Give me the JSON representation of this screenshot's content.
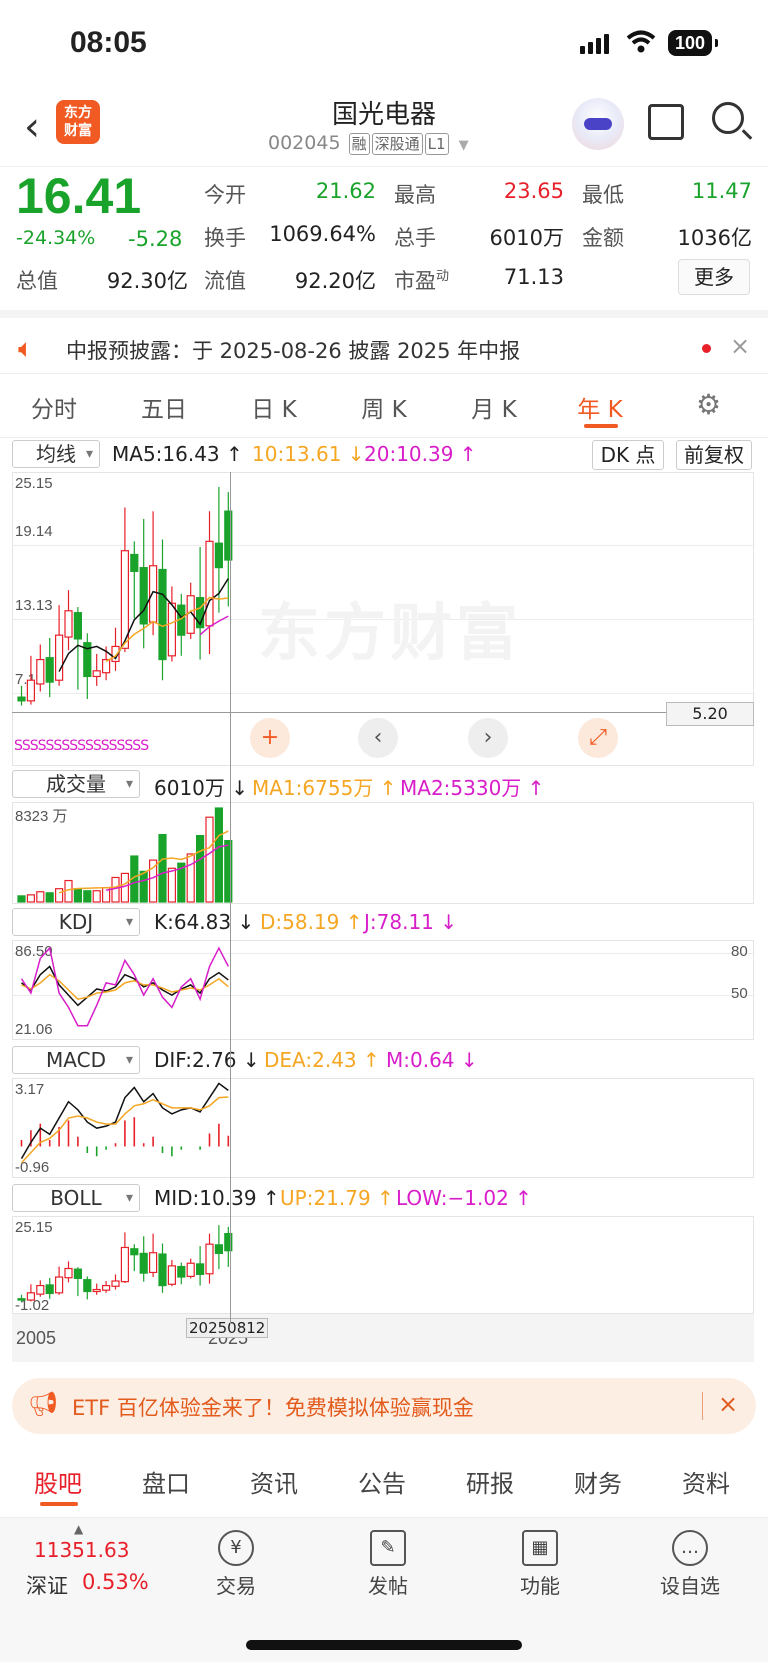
{
  "status": {
    "time": "08:05",
    "battery": "100"
  },
  "header": {
    "title": "国光电器",
    "code": "002045",
    "tags": [
      "融",
      "深股通",
      "L1"
    ],
    "logo_line1": "东方",
    "logo_line2": "财富",
    "back": "‹"
  },
  "quote": {
    "price": "16.41",
    "change_pct": "-24.34%",
    "change": "-5.28",
    "fields": [
      {
        "label": "今开",
        "value": "21.62",
        "color": "#1aa32b"
      },
      {
        "label": "最高",
        "value": "23.65",
        "color": "#e8202a"
      },
      {
        "label": "最低",
        "value": "11.47",
        "color": "#1aa32b"
      },
      {
        "label": "换手",
        "value": "1069.64%",
        "color": "#222"
      },
      {
        "label": "总手",
        "value": "6010万",
        "color": "#222"
      },
      {
        "label": "金额",
        "value": "1036亿",
        "color": "#222"
      },
      {
        "label": "总值",
        "value": "92.30亿",
        "color": "#222"
      },
      {
        "label": "流值",
        "value": "92.20亿",
        "color": "#222"
      },
      {
        "label": "市盈",
        "sup": "动",
        "value": "71.13",
        "color": "#222"
      }
    ],
    "more": "更多"
  },
  "notice": {
    "text": "中报预披露：于 2025-08-26 披露 2025 年中报",
    "close": "×"
  },
  "tabs": {
    "items": [
      "分时",
      "五日",
      "日 K",
      "周 K",
      "月 K",
      "年 K"
    ],
    "active": 5
  },
  "kline": {
    "selector": "均线",
    "ma5": "MA5:16.43 ↑",
    "ma10": "10:13.61 ↓",
    "ma20": "20:10.39 ↑",
    "dk": "DK 点",
    "fq": "前复权",
    "ylabels": [
      "25.15",
      "19.14",
      "13.13",
      "7.11"
    ],
    "crosshair_value": "5.20",
    "s_markers": "SSSSSSSSSSSSSSSSS"
  },
  "volume": {
    "selector": "成交量",
    "value": "6010万 ↓",
    "ma1": "MA1:6755万 ↑",
    "ma2": "MA2:5330万 ↑",
    "ylabel": "8323 万"
  },
  "kdj": {
    "selector": "KDJ",
    "k": "K:64.83 ↓",
    "d": "D:58.19 ↑",
    "j": "J:78.11 ↓",
    "ytop": "86.50",
    "ybot": "21.06",
    "r80": "80",
    "r50": "50"
  },
  "macd": {
    "selector": "MACD",
    "dif": "DIF:2.76 ↓",
    "dea": "DEA:2.43 ↑",
    "m": "M:0.64 ↓",
    "ytop": "3.17",
    "ybot": "-0.96"
  },
  "boll": {
    "selector": "BOLL",
    "mid": "MID:10.39 ↑",
    "up": "UP:21.79 ↑",
    "low": "LOW:−1.02 ↑",
    "ytop": "25.15",
    "ybot": "-1.02"
  },
  "xaxis": {
    "start": "2005",
    "end": "2025",
    "crosshair": "20250812"
  },
  "watermark": "东方财富",
  "ad": {
    "text": "ETF 百亿体验金来了！免费模拟体验赢现金",
    "close": "×"
  },
  "bottom_tabs": {
    "items": [
      "股吧",
      "盘口",
      "资讯",
      "公告",
      "研报",
      "财务",
      "资料"
    ],
    "active": 0
  },
  "bottom": {
    "index_value": "11351.63",
    "index_name": "深证",
    "index_pct": "0.53%",
    "tools": [
      {
        "label": "交易",
        "glyph": "¥"
      },
      {
        "label": "发帖",
        "glyph": "✎"
      },
      {
        "label": "功能",
        "glyph": "▦"
      },
      {
        "label": "设自选",
        "glyph": "…"
      }
    ]
  },
  "chart_data": {
    "type": "candlestick",
    "period": "year",
    "candles": [
      {
        "o": 1.8,
        "c": 1.4,
        "h": 3.0,
        "l": 0.9
      },
      {
        "o": 1.4,
        "c": 3.6,
        "h": 6.2,
        "l": 1.0
      },
      {
        "o": 3.2,
        "c": 5.8,
        "h": 7.4,
        "l": 2.4
      },
      {
        "o": 6.0,
        "c": 3.4,
        "h": 8.1,
        "l": 1.8
      },
      {
        "o": 3.6,
        "c": 8.4,
        "h": 11.6,
        "l": 3.0
      },
      {
        "o": 8.2,
        "c": 11.0,
        "h": 13.2,
        "l": 6.8
      },
      {
        "o": 10.8,
        "c": 8.0,
        "h": 11.4,
        "l": 2.6
      },
      {
        "o": 7.6,
        "c": 4.0,
        "h": 8.6,
        "l": 1.6
      },
      {
        "o": 4.0,
        "c": 4.6,
        "h": 6.4,
        "l": 3.0
      },
      {
        "o": 4.4,
        "c": 5.8,
        "h": 7.2,
        "l": 3.6
      },
      {
        "o": 5.6,
        "c": 7.2,
        "h": 9.2,
        "l": 4.6
      },
      {
        "o": 7.0,
        "c": 17.4,
        "h": 22.0,
        "l": 6.6
      },
      {
        "o": 17.0,
        "c": 15.2,
        "h": 18.4,
        "l": 10.2
      },
      {
        "o": 15.6,
        "c": 9.6,
        "h": 20.8,
        "l": 7.0
      },
      {
        "o": 9.8,
        "c": 15.8,
        "h": 21.6,
        "l": 8.4
      },
      {
        "o": 15.4,
        "c": 5.8,
        "h": 18.6,
        "l": 3.6
      },
      {
        "o": 6.2,
        "c": 11.8,
        "h": 13.6,
        "l": 5.6
      },
      {
        "o": 11.6,
        "c": 8.4,
        "h": 12.8,
        "l": 6.2
      },
      {
        "o": 8.6,
        "c": 12.6,
        "h": 14.0,
        "l": 8.0
      },
      {
        "o": 12.4,
        "c": 9.2,
        "h": 17.8,
        "l": 5.8
      },
      {
        "o": 9.4,
        "c": 18.4,
        "h": 21.6,
        "l": 6.4
      },
      {
        "o": 18.2,
        "c": 15.6,
        "h": 24.2,
        "l": 10.8
      },
      {
        "o": 21.62,
        "c": 16.41,
        "h": 23.65,
        "l": 11.47
      }
    ],
    "volume": [
      600,
      700,
      1000,
      900,
      1300,
      2100,
      1300,
      1100,
      1100,
      1400,
      2400,
      2800,
      4500,
      3000,
      4100,
      6600,
      3300,
      3800,
      4700,
      6500,
      8300,
      9200,
      6010
    ]
  }
}
